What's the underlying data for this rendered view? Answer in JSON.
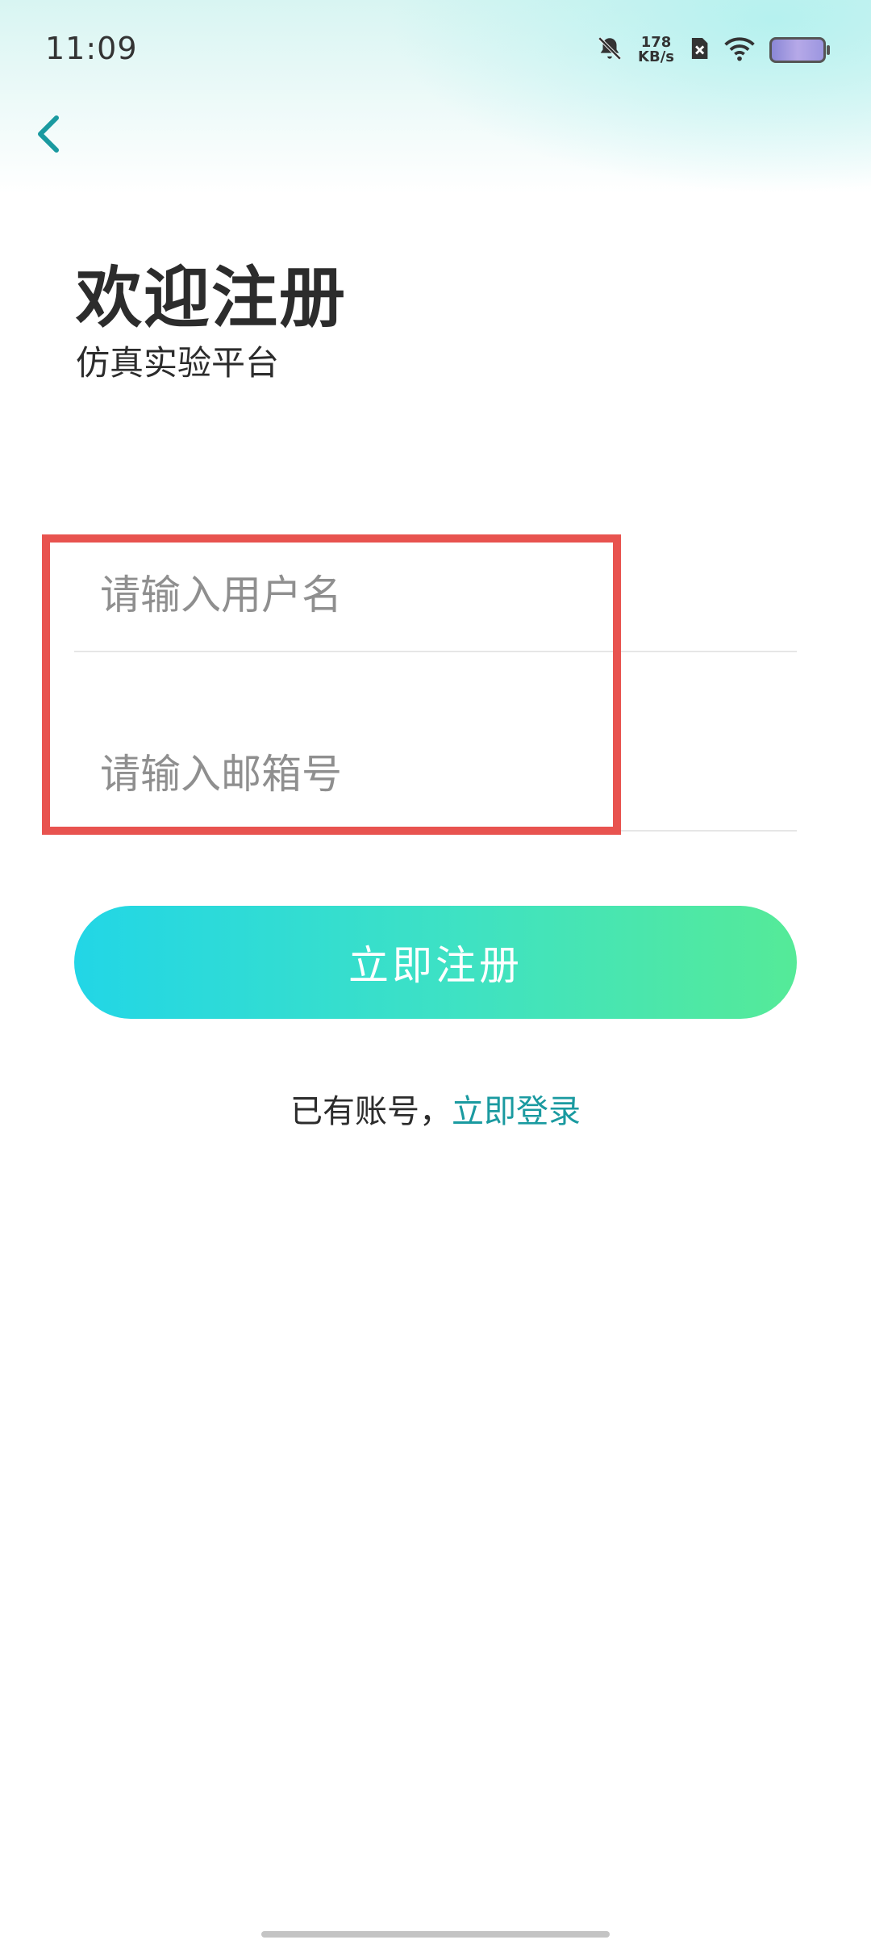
{
  "status_bar": {
    "time": "11:09",
    "speed_value": "178",
    "speed_unit": "KB/s",
    "icons": [
      "bell-off-icon",
      "sim-off-icon",
      "wifi-icon",
      "battery-icon"
    ]
  },
  "header": {
    "back_icon": "chevron-left-icon"
  },
  "page": {
    "title": "欢迎注册",
    "subtitle": "仿真实验平台"
  },
  "form": {
    "username": {
      "value": "",
      "placeholder": "请输入用户名"
    },
    "email": {
      "value": "",
      "placeholder": "请输入邮箱号"
    },
    "submit_label": "立即注册"
  },
  "footer": {
    "prompt": "已有账号，",
    "login_link": "立即登录"
  },
  "colors": {
    "accent_link": "#1a9aa0",
    "button_gradient_start": "#22d6e6",
    "button_gradient_end": "#55ea98",
    "highlight": "#e8534f"
  }
}
